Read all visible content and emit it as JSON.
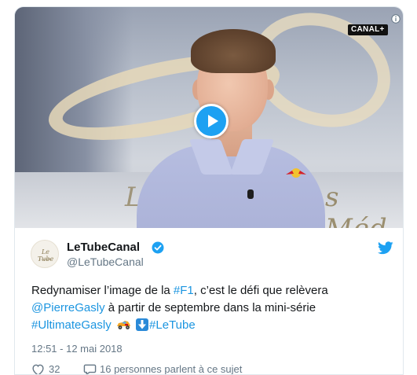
{
  "video": {
    "channel_badge": "CANAL+",
    "play_icon": "play-icon",
    "info_icon": "info-icon",
    "studio_text_right": "s Méd",
    "studio_text_left": "L"
  },
  "author": {
    "avatar_text": "Le Tube",
    "avatar_subtext": "CANAL",
    "name": "LeTubeCanal",
    "handle": "@LeTubeCanal",
    "verified_icon": "verified-badge-icon",
    "platform_icon": "twitter-bird-icon"
  },
  "tweet": {
    "part1": "Redynamiser l’image de la ",
    "hashtag_f1": "#F1",
    "part2": ", c’est le défi que relèvera ",
    "mention": "@PierreGasly",
    "part3": " à partir de septembre dans la mini-série ",
    "hashtag_ultimate": "#UltimateGasly",
    "emoji_car": "racing-car-emoji",
    "emoji_arrow": "down-arrow-emoji",
    "hashtag_letube": "#LeTube"
  },
  "meta": {
    "timestamp": "12:51 - 12 mai 2018",
    "like_count": "32",
    "reply_text": "16 personnes parlent à ce sujet"
  },
  "colors": {
    "link": "#1b95e0",
    "play_button": "#1da1f2",
    "secondary_text": "#657786"
  }
}
